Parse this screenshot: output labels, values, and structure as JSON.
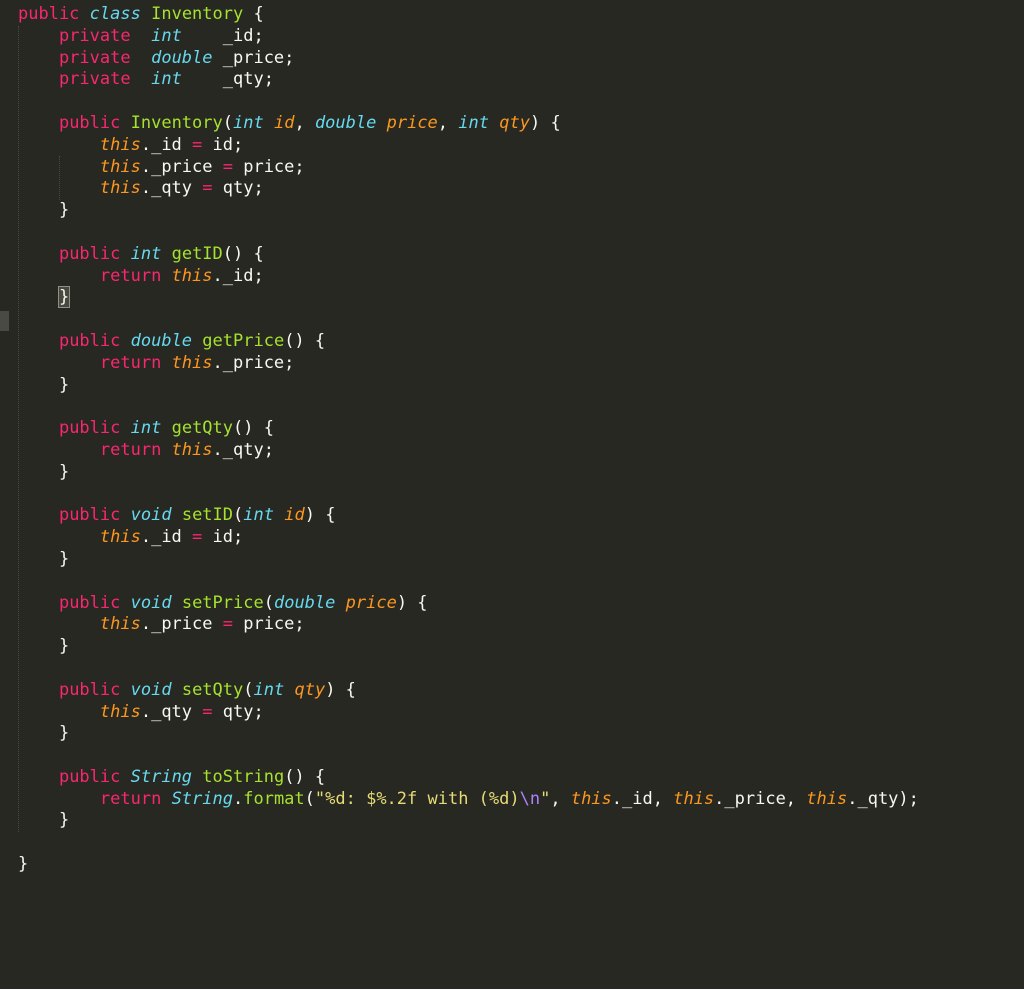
{
  "editor": {
    "theme_colors": {
      "background": "#272822",
      "keyword": "#f92672",
      "type": "#66d9ef",
      "function": "#a6e22e",
      "parameter": "#fd971f",
      "string": "#e6db74",
      "escape": "#ae81ff",
      "text": "#f8f8f2"
    },
    "lines": [
      [
        [
          "kw",
          "public"
        ],
        [
          "plain",
          " "
        ],
        [
          "type",
          "class"
        ],
        [
          "plain",
          " "
        ],
        [
          "cls",
          "Inventory"
        ],
        [
          "plain",
          " {"
        ]
      ],
      [
        [
          "plain",
          "    "
        ],
        [
          "kw",
          "private"
        ],
        [
          "plain",
          "  "
        ],
        [
          "type",
          "int"
        ],
        [
          "plain",
          "    _id;"
        ]
      ],
      [
        [
          "plain",
          "    "
        ],
        [
          "kw",
          "private"
        ],
        [
          "plain",
          "  "
        ],
        [
          "type",
          "double"
        ],
        [
          "plain",
          " _price;"
        ]
      ],
      [
        [
          "plain",
          "    "
        ],
        [
          "kw",
          "private"
        ],
        [
          "plain",
          "  "
        ],
        [
          "type",
          "int"
        ],
        [
          "plain",
          "    _qty;"
        ]
      ],
      [],
      [
        [
          "plain",
          "    "
        ],
        [
          "kw",
          "public"
        ],
        [
          "plain",
          " "
        ],
        [
          "cls",
          "Inventory"
        ],
        [
          "plain",
          "("
        ],
        [
          "type",
          "int"
        ],
        [
          "plain",
          " "
        ],
        [
          "param",
          "id"
        ],
        [
          "plain",
          ", "
        ],
        [
          "type",
          "double"
        ],
        [
          "plain",
          " "
        ],
        [
          "param",
          "price"
        ],
        [
          "plain",
          ", "
        ],
        [
          "type",
          "int"
        ],
        [
          "plain",
          " "
        ],
        [
          "param",
          "qty"
        ],
        [
          "plain",
          ") {"
        ]
      ],
      [
        [
          "plain",
          "        "
        ],
        [
          "this",
          "this"
        ],
        [
          "plain",
          "._id "
        ],
        [
          "op",
          "="
        ],
        [
          "plain",
          " id;"
        ]
      ],
      [
        [
          "plain",
          "        "
        ],
        [
          "this",
          "this"
        ],
        [
          "plain",
          "._price "
        ],
        [
          "op",
          "="
        ],
        [
          "plain",
          " price;"
        ]
      ],
      [
        [
          "plain",
          "        "
        ],
        [
          "this",
          "this"
        ],
        [
          "plain",
          "._qty "
        ],
        [
          "op",
          "="
        ],
        [
          "plain",
          " qty;"
        ]
      ],
      [
        [
          "plain",
          "    }"
        ]
      ],
      [],
      [
        [
          "plain",
          "    "
        ],
        [
          "kw",
          "public"
        ],
        [
          "plain",
          " "
        ],
        [
          "type",
          "int"
        ],
        [
          "plain",
          " "
        ],
        [
          "fn",
          "getID"
        ],
        [
          "plain",
          "() {"
        ]
      ],
      [
        [
          "plain",
          "        "
        ],
        [
          "kw",
          "return"
        ],
        [
          "plain",
          " "
        ],
        [
          "this",
          "this"
        ],
        [
          "plain",
          "._id;"
        ]
      ],
      [
        [
          "plain",
          "    "
        ],
        [
          "hl",
          "}"
        ]
      ],
      [],
      [
        [
          "plain",
          "    "
        ],
        [
          "kw",
          "public"
        ],
        [
          "plain",
          " "
        ],
        [
          "type",
          "double"
        ],
        [
          "plain",
          " "
        ],
        [
          "fn",
          "getPrice"
        ],
        [
          "plain",
          "() {"
        ]
      ],
      [
        [
          "plain",
          "        "
        ],
        [
          "kw",
          "return"
        ],
        [
          "plain",
          " "
        ],
        [
          "this",
          "this"
        ],
        [
          "plain",
          "._price;"
        ]
      ],
      [
        [
          "plain",
          "    }"
        ]
      ],
      [],
      [
        [
          "plain",
          "    "
        ],
        [
          "kw",
          "public"
        ],
        [
          "plain",
          " "
        ],
        [
          "type",
          "int"
        ],
        [
          "plain",
          " "
        ],
        [
          "fn",
          "getQty"
        ],
        [
          "plain",
          "() {"
        ]
      ],
      [
        [
          "plain",
          "        "
        ],
        [
          "kw",
          "return"
        ],
        [
          "plain",
          " "
        ],
        [
          "this",
          "this"
        ],
        [
          "plain",
          "._qty;"
        ]
      ],
      [
        [
          "plain",
          "    }"
        ]
      ],
      [],
      [
        [
          "plain",
          "    "
        ],
        [
          "kw",
          "public"
        ],
        [
          "plain",
          " "
        ],
        [
          "type",
          "void"
        ],
        [
          "plain",
          " "
        ],
        [
          "fn",
          "setID"
        ],
        [
          "plain",
          "("
        ],
        [
          "type",
          "int"
        ],
        [
          "plain",
          " "
        ],
        [
          "param",
          "id"
        ],
        [
          "plain",
          ") {"
        ]
      ],
      [
        [
          "plain",
          "        "
        ],
        [
          "this",
          "this"
        ],
        [
          "plain",
          "._id "
        ],
        [
          "op",
          "="
        ],
        [
          "plain",
          " id;"
        ]
      ],
      [
        [
          "plain",
          "    }"
        ]
      ],
      [],
      [
        [
          "plain",
          "    "
        ],
        [
          "kw",
          "public"
        ],
        [
          "plain",
          " "
        ],
        [
          "type",
          "void"
        ],
        [
          "plain",
          " "
        ],
        [
          "fn",
          "setPrice"
        ],
        [
          "plain",
          "("
        ],
        [
          "type",
          "double"
        ],
        [
          "plain",
          " "
        ],
        [
          "param",
          "price"
        ],
        [
          "plain",
          ") {"
        ]
      ],
      [
        [
          "plain",
          "        "
        ],
        [
          "this",
          "this"
        ],
        [
          "plain",
          "._price "
        ],
        [
          "op",
          "="
        ],
        [
          "plain",
          " price;"
        ]
      ],
      [
        [
          "plain",
          "    }"
        ]
      ],
      [],
      [
        [
          "plain",
          "    "
        ],
        [
          "kw",
          "public"
        ],
        [
          "plain",
          " "
        ],
        [
          "type",
          "void"
        ],
        [
          "plain",
          " "
        ],
        [
          "fn",
          "setQty"
        ],
        [
          "plain",
          "("
        ],
        [
          "type",
          "int"
        ],
        [
          "plain",
          " "
        ],
        [
          "param",
          "qty"
        ],
        [
          "plain",
          ") {"
        ]
      ],
      [
        [
          "plain",
          "        "
        ],
        [
          "this",
          "this"
        ],
        [
          "plain",
          "._qty "
        ],
        [
          "op",
          "="
        ],
        [
          "plain",
          " qty;"
        ]
      ],
      [
        [
          "plain",
          "    }"
        ]
      ],
      [],
      [
        [
          "plain",
          "    "
        ],
        [
          "kw",
          "public"
        ],
        [
          "plain",
          " "
        ],
        [
          "type",
          "String"
        ],
        [
          "plain",
          " "
        ],
        [
          "fn",
          "toString"
        ],
        [
          "plain",
          "() {"
        ]
      ],
      [
        [
          "plain",
          "        "
        ],
        [
          "kw",
          "return"
        ],
        [
          "plain",
          " "
        ],
        [
          "type",
          "String"
        ],
        [
          "plain",
          "."
        ],
        [
          "fn",
          "format"
        ],
        [
          "plain",
          "("
        ],
        [
          "str",
          "\"%d: $%.2f with (%d)"
        ],
        [
          "esc",
          "\\n"
        ],
        [
          "str",
          "\""
        ],
        [
          "plain",
          ", "
        ],
        [
          "this",
          "this"
        ],
        [
          "plain",
          "._id, "
        ],
        [
          "this",
          "this"
        ],
        [
          "plain",
          "._price, "
        ],
        [
          "this",
          "this"
        ],
        [
          "plain",
          "._qty);"
        ]
      ],
      [
        [
          "plain",
          "    }"
        ]
      ],
      [],
      [
        [
          "plain",
          "}"
        ]
      ]
    ]
  }
}
